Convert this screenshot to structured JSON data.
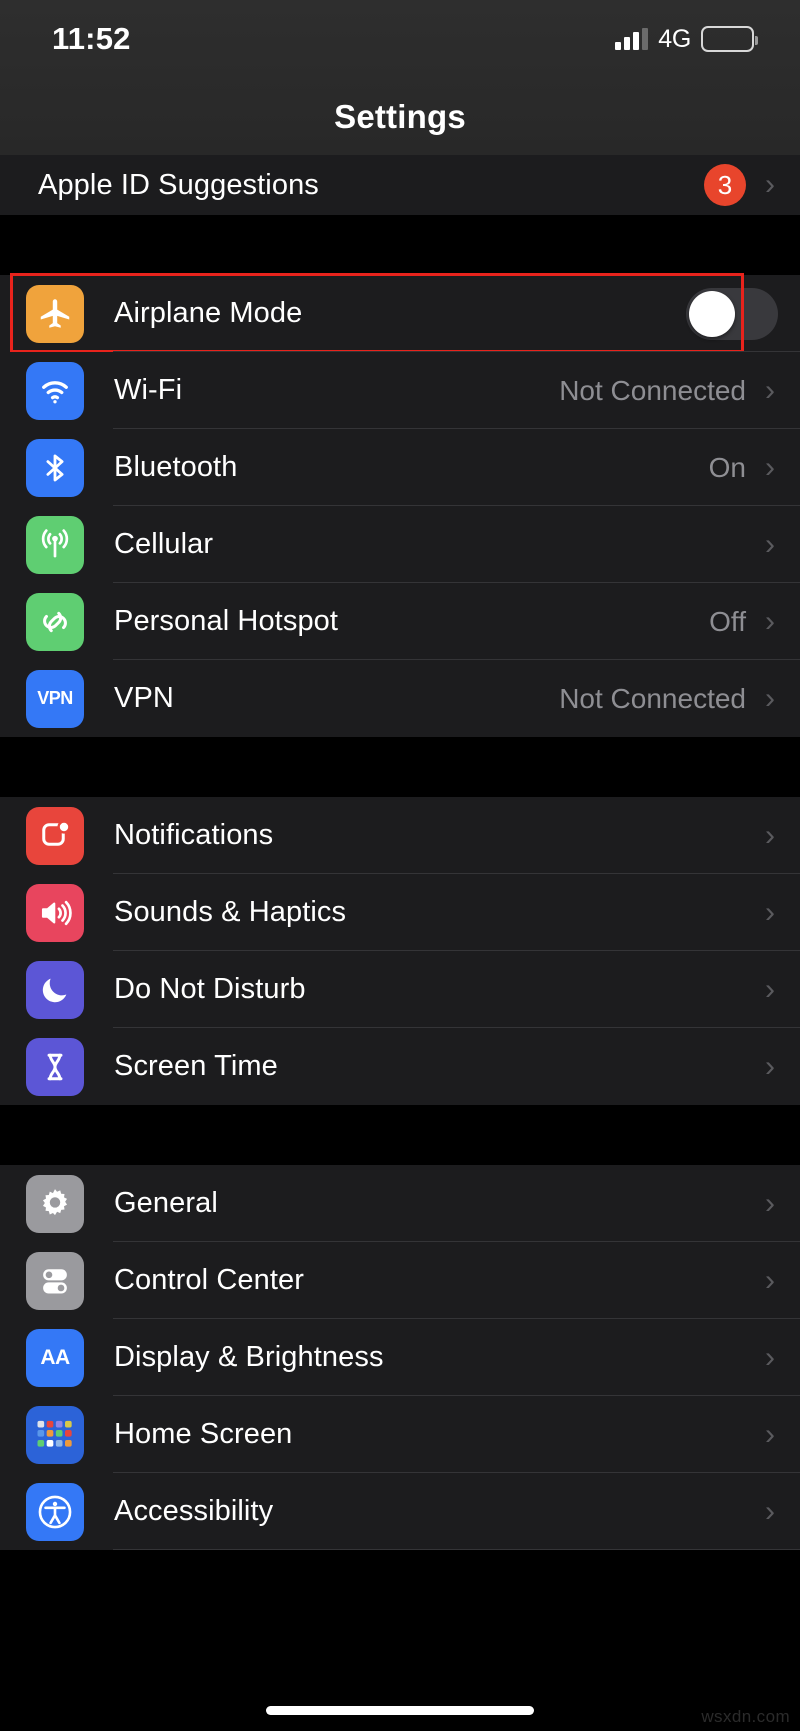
{
  "status_bar": {
    "time": "11:52",
    "network_label": "4G",
    "signal_icon": "cellular-signal-icon",
    "battery_icon": "battery-icon"
  },
  "header": {
    "title": "Settings"
  },
  "colors": {
    "accent_red": "#e8231c",
    "badge_red": "#e8452c",
    "row_bg": "#1c1c1e",
    "separator": "#343437",
    "value_gray": "#8e8e93",
    "toggle_off_track": "#39393d"
  },
  "highlight": {
    "target": "Airplane Mode",
    "border_color": "#e8231c"
  },
  "groups": [
    {
      "name": "apple-id-group",
      "rows": [
        {
          "label": "Apple ID Suggestions",
          "icon": "none",
          "badge": "3",
          "value": "",
          "accessory": "chevron"
        }
      ]
    },
    {
      "name": "connectivity-group",
      "rows": [
        {
          "label": "Airplane Mode",
          "icon": "airplane-icon",
          "icon_color": "#f0a33c",
          "value": "",
          "accessory": "toggle",
          "toggle_state": "off",
          "highlighted": true
        },
        {
          "label": "Wi-Fi",
          "icon": "wifi-icon",
          "icon_color": "#3478f6",
          "value": "Not Connected",
          "accessory": "chevron"
        },
        {
          "label": "Bluetooth",
          "icon": "bluetooth-icon",
          "icon_color": "#3478f6",
          "value": "On",
          "accessory": "chevron"
        },
        {
          "label": "Cellular",
          "icon": "cellular-antenna-icon",
          "icon_color": "#5fce72",
          "value": "",
          "accessory": "chevron"
        },
        {
          "label": "Personal Hotspot",
          "icon": "hotspot-link-icon",
          "icon_color": "#5fce72",
          "value": "Off",
          "accessory": "chevron"
        },
        {
          "label": "VPN",
          "icon": "vpn-icon",
          "icon_color": "#3478f6",
          "value": "Not Connected",
          "accessory": "chevron"
        }
      ]
    },
    {
      "name": "notifications-group",
      "rows": [
        {
          "label": "Notifications",
          "icon": "notifications-badge-icon",
          "icon_color": "#e8453c",
          "value": "",
          "accessory": "chevron"
        },
        {
          "label": "Sounds & Haptics",
          "icon": "speaker-icon",
          "icon_color": "#e8455e",
          "value": "",
          "accessory": "chevron"
        },
        {
          "label": "Do Not Disturb",
          "icon": "moon-icon",
          "icon_color": "#5c56d6",
          "value": "",
          "accessory": "chevron"
        },
        {
          "label": "Screen Time",
          "icon": "hourglass-icon",
          "icon_color": "#5c56d6",
          "value": "",
          "accessory": "chevron"
        }
      ]
    },
    {
      "name": "general-group",
      "rows": [
        {
          "label": "General",
          "icon": "gear-icon",
          "icon_color": "#9a9a9e",
          "value": "",
          "accessory": "chevron"
        },
        {
          "label": "Control Center",
          "icon": "control-center-toggles-icon",
          "icon_color": "#9a9a9e",
          "value": "",
          "accessory": "chevron"
        },
        {
          "label": "Display & Brightness",
          "icon": "display-aa-icon",
          "icon_color": "#3478f6",
          "icon_text": "AA",
          "value": "",
          "accessory": "chevron"
        },
        {
          "label": "Home Screen",
          "icon": "home-screen-grid-icon",
          "icon_color": "#2c63d8",
          "value": "",
          "accessory": "chevron"
        },
        {
          "label": "Accessibility",
          "icon": "accessibility-icon",
          "icon_color": "#3478f6",
          "value": "",
          "accessory": "chevron"
        }
      ]
    }
  ],
  "footer": {
    "watermark": "wsxdn.com",
    "home_indicator": "home-indicator"
  }
}
